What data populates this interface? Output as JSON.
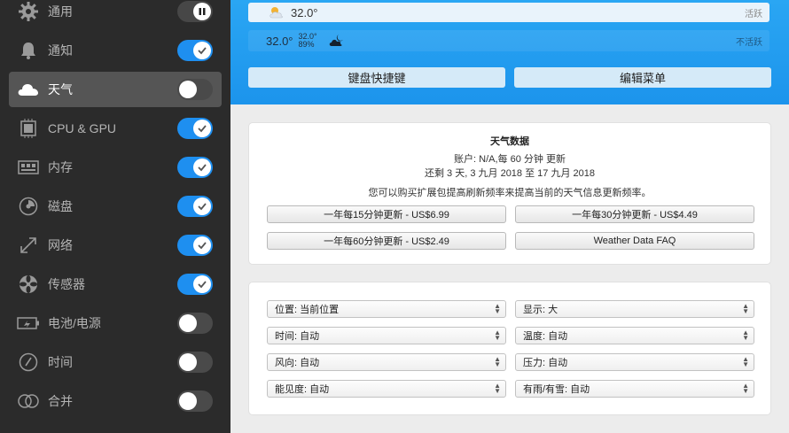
{
  "sidebar": {
    "items": [
      {
        "label": "通用",
        "toggle": "pause"
      },
      {
        "label": "通知",
        "toggle": "on"
      },
      {
        "label": "天气",
        "toggle": "off",
        "selected": true
      },
      {
        "label": "CPU & GPU",
        "toggle": "on"
      },
      {
        "label": "内存",
        "toggle": "on"
      },
      {
        "label": "磁盘",
        "toggle": "on"
      },
      {
        "label": "网络",
        "toggle": "on"
      },
      {
        "label": "传感器",
        "toggle": "on"
      },
      {
        "label": "电池/电源",
        "toggle": "off"
      },
      {
        "label": "时间",
        "toggle": "off"
      },
      {
        "label": "合并",
        "toggle": "off"
      }
    ]
  },
  "preview": {
    "active": {
      "temp": "32.0°",
      "state": "活跃"
    },
    "inactive": {
      "temp": "32.0°",
      "mini_temp": "32.0°",
      "mini_humidity": "89%",
      "state": "不活跃"
    }
  },
  "top_buttons": {
    "shortcuts": "键盘快捷键",
    "edit_menu": "编辑菜单"
  },
  "weather_data": {
    "title": "天气数据",
    "account": "账户: N/A,每 60 分钟 更新",
    "remaining": "还剩 3 天, 3 九月 2018 至 17 九月 2018",
    "upsell": "您可以购买扩展包提高刷新频率来提高当前的天气信息更新频率。",
    "buttons": [
      "一年每15分钟更新 - US$6.99",
      "一年每30分钟更新 - US$4.49",
      "一年每60分钟更新 - US$2.49",
      "Weather Data FAQ"
    ]
  },
  "settings": {
    "selects": [
      "位置: 当前位置",
      "显示:  大",
      "时间: 自动",
      "温度: 自动",
      "风向: 自动",
      "压力: 自动",
      "能见度: 自动",
      "有雨/有雪: 自动"
    ]
  },
  "colors": {
    "accent": "#1e8ff0",
    "banner": "#2aa6f3",
    "sidebar": "#2b2b2b"
  }
}
